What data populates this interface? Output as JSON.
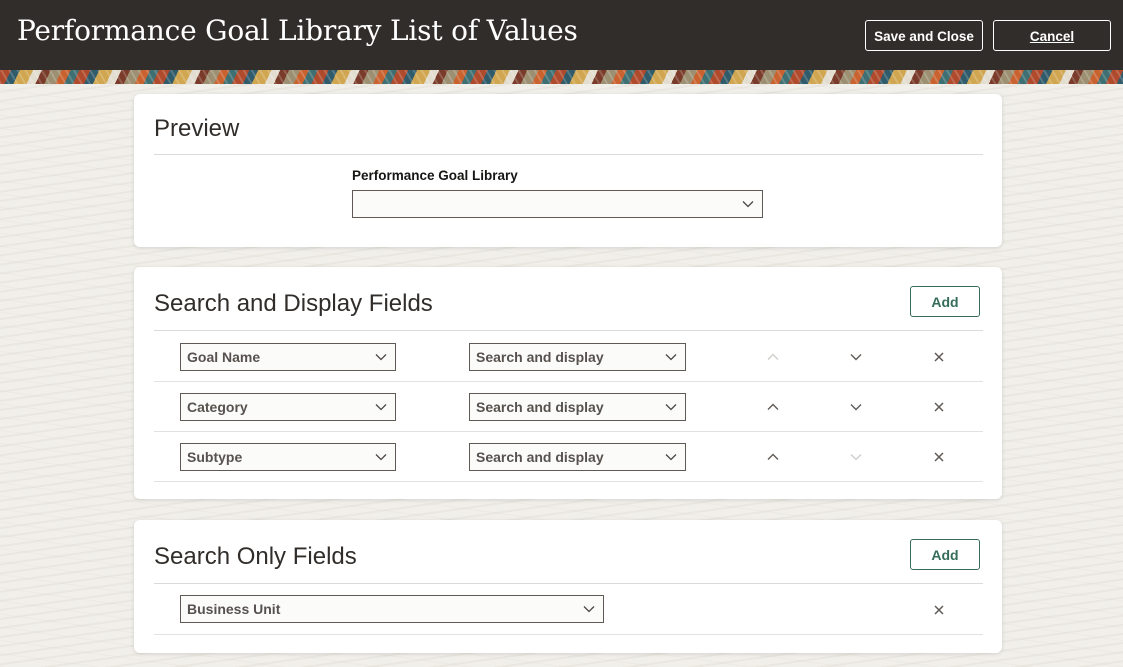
{
  "header": {
    "title": "Performance Goal Library List of Values",
    "save_close_label": "Save and Close",
    "cancel_label": "Cancel"
  },
  "preview": {
    "title": "Preview",
    "field_label": "Performance Goal Library",
    "field_value": ""
  },
  "search_display": {
    "title": "Search and Display Fields",
    "add_label": "Add",
    "rows": [
      {
        "field": "Goal Name",
        "mode": "Search and display",
        "move_up_enabled": false,
        "move_down_enabled": true
      },
      {
        "field": "Category",
        "mode": "Search and display",
        "move_up_enabled": true,
        "move_down_enabled": true
      },
      {
        "field": "Subtype",
        "mode": "Search and display",
        "move_up_enabled": true,
        "move_down_enabled": false
      }
    ]
  },
  "search_only": {
    "title": "Search Only Fields",
    "add_label": "Add",
    "rows": [
      {
        "field": "Business Unit"
      }
    ]
  },
  "colors": {
    "header_bg": "#312d2a",
    "accent_green": "#356d5a",
    "text_dark": "#161513"
  },
  "icons": {
    "dropdown": "chevron-down-icon",
    "move_up": "chevron-up-icon",
    "move_down": "chevron-down-icon",
    "remove": "close-icon"
  }
}
